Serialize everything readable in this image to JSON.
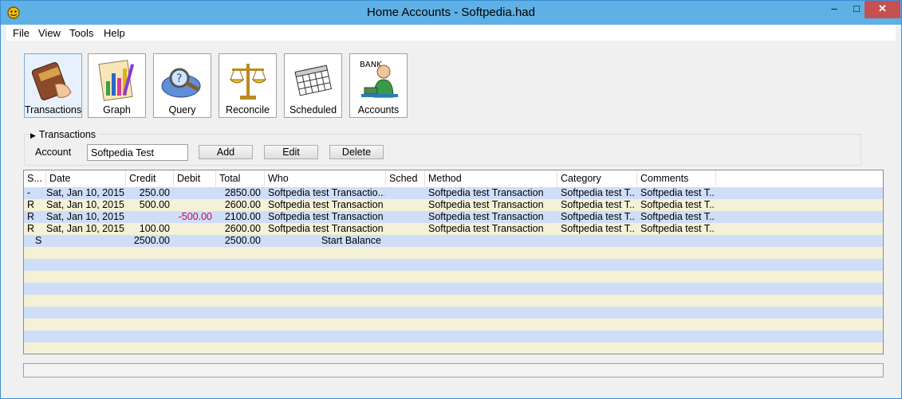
{
  "window": {
    "title": "Home Accounts - Softpedia.had",
    "minimize_glyph": "–",
    "maximize_glyph": "□",
    "close_glyph": "✕"
  },
  "menu": [
    "File",
    "View",
    "Tools",
    "Help"
  ],
  "toolbar": [
    {
      "label": "Transactions",
      "icon": "wallet-icon"
    },
    {
      "label": "Graph",
      "icon": "graph-icon"
    },
    {
      "label": "Query",
      "icon": "magnifier-icon"
    },
    {
      "label": "Reconcile",
      "icon": "scales-icon"
    },
    {
      "label": "Scheduled",
      "icon": "calendar-icon"
    },
    {
      "label": "Accounts",
      "icon": "bank-teller-icon",
      "badge": "BANK"
    }
  ],
  "panel": {
    "title": "Transactions",
    "account_label": "Account",
    "account_value": "Softpedia Test",
    "add_label": "Add",
    "edit_label": "Edit",
    "delete_label": "Delete"
  },
  "grid": {
    "columns": [
      "S...",
      "Date",
      "Credit",
      "Debit",
      "Total",
      "Who",
      "Sched",
      "Method",
      "Category",
      "Comments"
    ],
    "rows": [
      {
        "s": "-",
        "date": "Sat, Jan 10, 2015",
        "credit": "250.00",
        "debit": "",
        "total": "2850.00",
        "who": "Softpedia test Transactio...",
        "sched": "",
        "method": "Softpedia test Transaction",
        "category": "Softpedia test T...",
        "comments": "Softpedia test T..."
      },
      {
        "s": "R",
        "date": "Sat, Jan 10, 2015",
        "credit": "500.00",
        "debit": "",
        "total": "2600.00",
        "who": "Softpedia test Transaction",
        "sched": "",
        "method": "Softpedia test Transaction",
        "category": "Softpedia test T...",
        "comments": "Softpedia test T..."
      },
      {
        "s": "R",
        "date": "Sat, Jan 10, 2015",
        "credit": "",
        "debit": "-500.00",
        "total": "2100.00",
        "who": "Softpedia test Transaction",
        "sched": "",
        "method": "Softpedia test Transaction",
        "category": "Softpedia test T...",
        "comments": "Softpedia test T..."
      },
      {
        "s": "R",
        "date": "Sat, Jan 10, 2015",
        "credit": "100.00",
        "debit": "",
        "total": "2600.00",
        "who": "Softpedia test Transaction",
        "sched": "",
        "method": "Softpedia test Transaction",
        "category": "Softpedia test T...",
        "comments": "Softpedia test T..."
      },
      {
        "s": "S",
        "date": "",
        "credit": "2500.00",
        "debit": "",
        "total": "2500.00",
        "who": "Start Balance",
        "sched": "",
        "method": "",
        "category": "",
        "comments": ""
      }
    ]
  },
  "colors": {
    "row_blue": "#cfdef8",
    "row_yellow": "#f4f1d6",
    "negative": "#c8005a",
    "titlebar": "#5eb0e5"
  }
}
